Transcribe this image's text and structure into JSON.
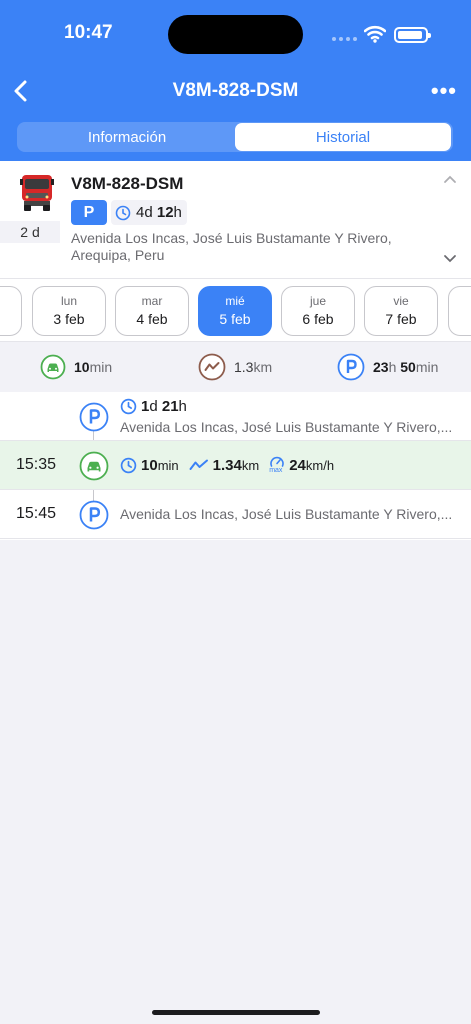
{
  "status_bar": {
    "time": "10:47"
  },
  "nav": {
    "title": "V8M-828-DSM"
  },
  "tabs": [
    {
      "label": "Información"
    },
    {
      "label": "Historial"
    }
  ],
  "vehicle": {
    "plate": "V8M-828-DSM",
    "days_badge": "2 d",
    "status": "P",
    "duration": {
      "d": "4",
      "du": "d",
      "h": "12",
      "hu": "h"
    },
    "address": "Avenida Los Incas, José Luis Bustamante Y Rivero, Arequipa, Peru"
  },
  "days": [
    {
      "dn": "lun",
      "dd": "3 feb"
    },
    {
      "dn": "mar",
      "dd": "4 feb"
    },
    {
      "dn": "mié",
      "dd": "5 feb",
      "active": true
    },
    {
      "dn": "jue",
      "dd": "6 feb"
    },
    {
      "dn": "vie",
      "dd": "7 feb"
    }
  ],
  "summary": {
    "drive": {
      "v": "10",
      "u": "min"
    },
    "distance": {
      "v": "1.3",
      "u": "km"
    },
    "park": {
      "v1": "23",
      "u1": "h",
      "v2": "50",
      "u2": "min"
    }
  },
  "timeline": [
    {
      "type": "parking",
      "time": "",
      "duration": {
        "v1": "1",
        "u1": "d",
        "v2": "21",
        "u2": "h"
      },
      "address": "Avenida Los Incas, José Luis Bustamante Y Rivero,..."
    },
    {
      "type": "drive",
      "time": "15:35",
      "duration": {
        "v": "10",
        "u": "min"
      },
      "distance": {
        "v": "1.34",
        "u": "km"
      },
      "speed": {
        "v": "24",
        "u": "km/h",
        "tag": "max"
      }
    },
    {
      "type": "parking",
      "time": "15:45",
      "address": "Avenida Los Incas, José Luis Bustamante Y Rivero,..."
    }
  ],
  "colors": {
    "accent": "#3b82f6",
    "drive": "#4caf50",
    "distance": "#8d5c4c"
  },
  "icons": {
    "back": "chevron-left-icon",
    "more": "more-icon",
    "truck": "truck-icon",
    "clock": "clock-icon",
    "parking": "parking-icon",
    "car": "car-icon",
    "route": "route-icon",
    "speed": "speedometer-icon"
  }
}
